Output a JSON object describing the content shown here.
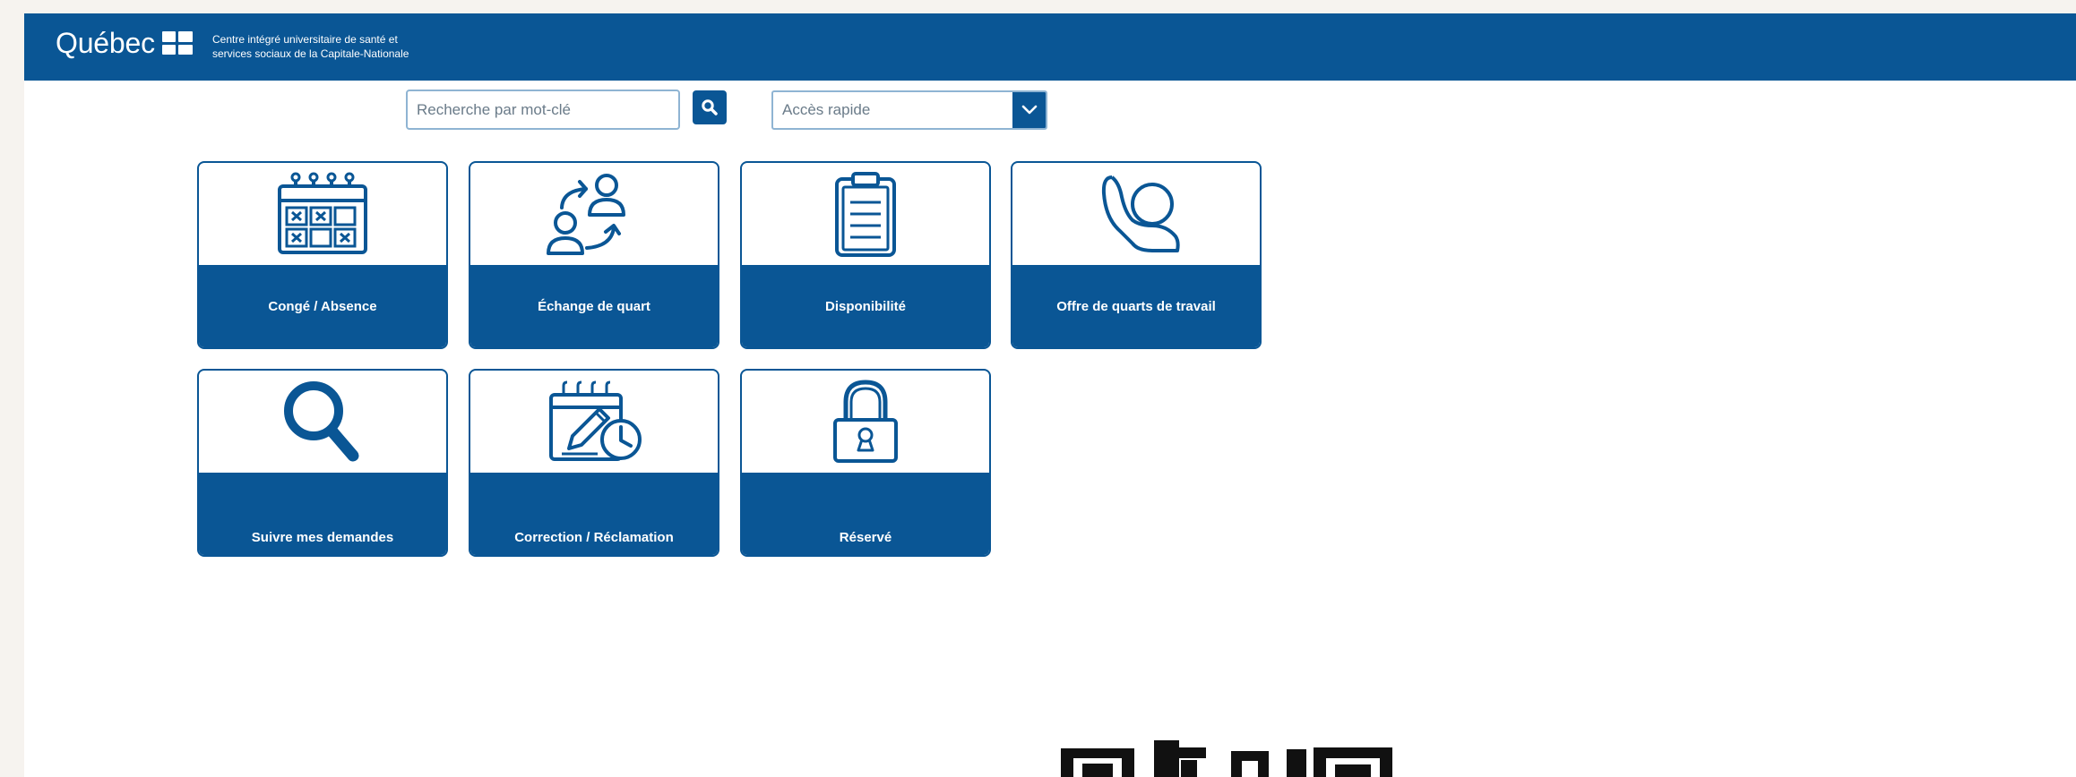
{
  "header": {
    "brand": "Québec",
    "organization": "Centre intégré universitaire de santé et\nservices sociaux de la Capitale-Nationale"
  },
  "search": {
    "placeholder": "Recherche par mot-clé",
    "button_icon": "search-icon"
  },
  "quick_access": {
    "selected": "Accès rapide",
    "icon": "chevron-down-icon"
  },
  "tiles": [
    {
      "label": "Congé / Absence",
      "icon": "calendar-x-icon"
    },
    {
      "label": "Échange de quart",
      "icon": "swap-people-icon"
    },
    {
      "label": "Disponibilité",
      "icon": "clipboard-icon"
    },
    {
      "label": "Offre de quarts de travail",
      "icon": "raised-hand-icon"
    },
    {
      "label": "Suivre mes demandes",
      "icon": "magnifier-icon"
    },
    {
      "label": "Correction / Réclamation",
      "icon": "calendar-edit-icon"
    },
    {
      "label": "Réservé",
      "icon": "padlock-icon"
    }
  ],
  "colors": {
    "brand_blue": "#0a5695",
    "field_border": "#8fb4d3",
    "page_background": "#f6f3ef"
  }
}
